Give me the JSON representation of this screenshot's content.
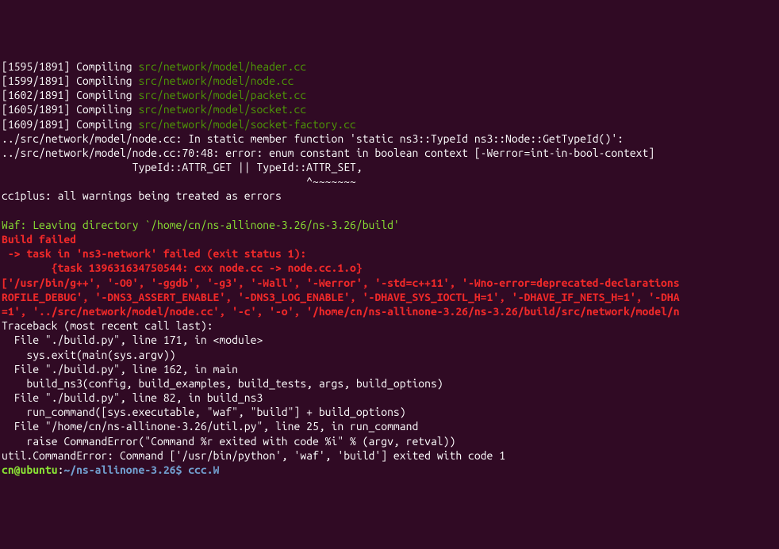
{
  "lines": [
    {
      "segments": [
        {
          "text": "[1595/1891] Compiling ",
          "class": "white"
        },
        {
          "text": "src/network/model/header.cc",
          "class": "green"
        }
      ]
    },
    {
      "segments": [
        {
          "text": "[1599/1891] Compiling ",
          "class": "white"
        },
        {
          "text": "src/network/model/node.cc",
          "class": "green"
        }
      ]
    },
    {
      "segments": [
        {
          "text": "[1602/1891] Compiling ",
          "class": "white"
        },
        {
          "text": "src/network/model/packet.cc",
          "class": "green"
        }
      ]
    },
    {
      "segments": [
        {
          "text": "[1605/1891] Compiling ",
          "class": "white"
        },
        {
          "text": "src/network/model/socket.cc",
          "class": "green"
        }
      ]
    },
    {
      "segments": [
        {
          "text": "[1609/1891] Compiling ",
          "class": "white"
        },
        {
          "text": "src/network/model/socket-factory.cc",
          "class": "green"
        }
      ]
    },
    {
      "segments": [
        {
          "text": "../src/network/model/node.cc: In static member function 'static ns3::TypeId ns3::Node::GetTypeId()':",
          "class": "white"
        }
      ]
    },
    {
      "segments": [
        {
          "text": "../src/network/model/node.cc:70:48: error: enum constant in boolean context [-Werror=int-in-bool-context]",
          "class": "white"
        }
      ]
    },
    {
      "segments": [
        {
          "text": "                     TypeId::ATTR_GET || TypeId::ATTR_SET,",
          "class": "white"
        }
      ]
    },
    {
      "segments": [
        {
          "text": "                                                 ^~~~~~~~",
          "class": "white"
        }
      ]
    },
    {
      "segments": [
        {
          "text": "cc1plus: all warnings being treated as errors",
          "class": "white"
        }
      ]
    },
    {
      "segments": [
        {
          "text": " ",
          "class": "white"
        }
      ]
    },
    {
      "segments": [
        {
          "text": "Waf: Leaving directory `/home/cn/ns-allinone-3.26/ns-3.26/build'",
          "class": "lime"
        }
      ]
    },
    {
      "segments": [
        {
          "text": "Build failed",
          "class": "red"
        }
      ]
    },
    {
      "segments": [
        {
          "text": " -> task in 'ns3-network' failed (exit status 1):",
          "class": "red"
        }
      ]
    },
    {
      "segments": [
        {
          "text": "        {task 139631634750544: cxx node.cc -> node.cc.1.o}",
          "class": "red"
        }
      ]
    },
    {
      "segments": [
        {
          "text": "['/usr/bin/g++', '-O0', '-ggdb', '-g3', '-Wall', '-Werror', '-std=c++11', '-Wno-error=deprecated-declarations",
          "class": "red"
        }
      ]
    },
    {
      "segments": [
        {
          "text": "ROFILE_DEBUG', '-DNS3_ASSERT_ENABLE', '-DNS3_LOG_ENABLE', '-DHAVE_SYS_IOCTL_H=1', '-DHAVE_IF_NETS_H=1', '-DHA",
          "class": "red"
        }
      ]
    },
    {
      "segments": [
        {
          "text": "=1', '../src/network/model/node.cc', '-c', '-o', '/home/cn/ns-allinone-3.26/ns-3.26/build/src/network/model/n",
          "class": "red"
        }
      ]
    },
    {
      "segments": [
        {
          "text": "Traceback (most recent call last):",
          "class": "white"
        }
      ]
    },
    {
      "segments": [
        {
          "text": "  File \"./build.py\", line 171, in <module>",
          "class": "white"
        }
      ]
    },
    {
      "segments": [
        {
          "text": "    sys.exit(main(sys.argv))",
          "class": "white"
        }
      ]
    },
    {
      "segments": [
        {
          "text": "  File \"./build.py\", line 162, in main",
          "class": "white"
        }
      ]
    },
    {
      "segments": [
        {
          "text": "    build_ns3(config, build_examples, build_tests, args, build_options)",
          "class": "white"
        }
      ]
    },
    {
      "segments": [
        {
          "text": "  File \"./build.py\", line 82, in build_ns3",
          "class": "white"
        }
      ]
    },
    {
      "segments": [
        {
          "text": "    run_command([sys.executable, \"waf\", \"build\"] + build_options)",
          "class": "white"
        }
      ]
    },
    {
      "segments": [
        {
          "text": "  File \"/home/cn/ns-allinone-3.26/util.py\", line 25, in run_command",
          "class": "white"
        }
      ]
    },
    {
      "segments": [
        {
          "text": "    raise CommandError(\"Command %r exited with code %i\" % (argv, retval))",
          "class": "white"
        }
      ]
    },
    {
      "segments": [
        {
          "text": "util.CommandError: Command ['/usr/bin/python', 'waf', 'build'] exited with code 1",
          "class": "white"
        }
      ]
    }
  ],
  "prompt": {
    "user_host": "cn@ubuntu",
    "colon": ":",
    "path_cmd": "~/ns-allinone-3.26$ ccc.W"
  }
}
